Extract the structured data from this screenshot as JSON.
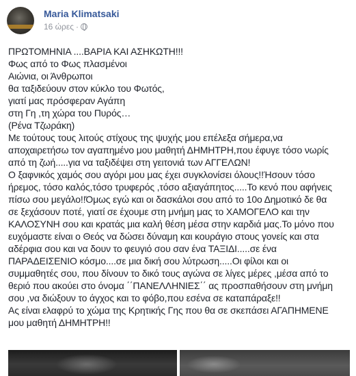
{
  "post": {
    "author": "Maria Klimatsaki",
    "timestamp": "16 ώρες",
    "separator": "·",
    "privacy_icon": "globe-icon",
    "lines": [
      "ΠΡΩΤΟΜΗΝΙΑ ....ΒΑΡΙΑ ΚΑΙ ΑΣΗΚΩΤΗ!!!",
      "Φως από το Φως πλασμένοι",
      "Αιώνια, οι Άνθρωποι",
      "θα ταξιδεύουν στον κύκλο του Φωτός,",
      "γιατί μας πρόσφεραν Αγάπη",
      "στη Γη ,τη χώρα του Πυρός…",
      "(Ρένα Τζωράκη)",
      "Με τούτους τους λιτούς στίχους της ψυχής μου επέλεξα σήμερα,να",
      "αποχαιρετήσω τον αγαπημένο μου μαθητή ΔΗΜΗΤΡΗ,που έφυγε τόσο νωρίς",
      "από τη ζωή.....για να ταξιδέψει στη γειτονιά των ΑΓΓΕΛΩΝ!",
      "Ο ξαφνικός χαμός σου αγόρι μου μας έχει συγκλονίσει όλους!!Ήσουν τόσο",
      "ήρεμος, τόσο καλός,τόσο τρυφερός ,τόσο αξιαγάπητος.....Το κενό που αφήνεις",
      "πίσω σου μεγάλο!!Όμως εγώ και οι δασκάλοι σου από το 10ο Δημοτικό δε θα",
      "σε ξεχάσουν ποτέ, γιατί σε έχουμε στη μνήμη μας το ΧΑΜΟΓΕΛΟ και την",
      "ΚΑΛΟΣΥΝΗ σου και κρατάς μια καλή θέση μέσα στην καρδιά μας.Το μόνο που",
      "ευχόμαστε είναι ο Θεός να δώσει δύναμη και κουράγιο στους γονείς και στα",
      "αδέρφια σου και να δουν το φευγιό σου σαν ένα ΤΑΞΙΔΙ.....σε ένα",
      "ΠΑΡΑΔΕΙΣΕΝΙΟ κόσμο....σε μια δική σου λύτρωση.....Οι φίλοι και οι",
      "συμμαθητές σου, που δίνουν το δικό τους αγώνα σε λίγες μέρες ,μέσα από το",
      "θεριό που ακούει στο όνομα ΄΄ΠΑΝΕΛΛΗΝΙΕΣ΄΄ ας προσπαθήσουν στη μνήμη",
      "σου ,να διώξουν το άγχος και το φόβο,που εσένα σε καταπάραξε!!",
      "Ας είναι ελαφρύ το χώμα της Κρητικής Γης που θα σε σκεπάσει ΑΓΑΠΗΜΕΝΕ",
      "μου μαθητή ΔΗΜΗΤΡΗ!!"
    ]
  }
}
